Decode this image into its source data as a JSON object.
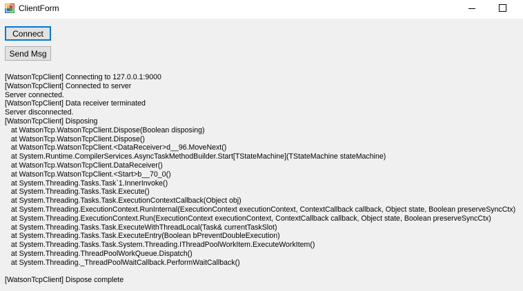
{
  "window": {
    "title": "ClientForm"
  },
  "buttons": {
    "connect": "Connect",
    "send": "Send Msg"
  },
  "log": [
    "[WatsonTcpClient] Connecting to 127.0.0.1:9000",
    "[WatsonTcpClient] Connected to server",
    "Server connected.",
    "[WatsonTcpClient] Data receiver terminated",
    "Server disconnected.",
    "[WatsonTcpClient] Disposing",
    "   at WatsonTcp.WatsonTcpClient.Dispose(Boolean disposing)",
    "   at WatsonTcp.WatsonTcpClient.Dispose()",
    "   at WatsonTcp.WatsonTcpClient.<DataReceiver>d__96.MoveNext()",
    "   at System.Runtime.CompilerServices.AsyncTaskMethodBuilder.Start[TStateMachine](TStateMachine stateMachine)",
    "   at WatsonTcp.WatsonTcpClient.DataReceiver()",
    "   at WatsonTcp.WatsonTcpClient.<Start>b__70_0()",
    "   at System.Threading.Tasks.Task`1.InnerInvoke()",
    "   at System.Threading.Tasks.Task.Execute()",
    "   at System.Threading.Tasks.Task.ExecutionContextCallback(Object obj)",
    "   at System.Threading.ExecutionContext.RunInternal(ExecutionContext executionContext, ContextCallback callback, Object state, Boolean preserveSyncCtx)",
    "   at System.Threading.ExecutionContext.Run(ExecutionContext executionContext, ContextCallback callback, Object state, Boolean preserveSyncCtx)",
    "   at System.Threading.Tasks.Task.ExecuteWithThreadLocal(Task& currentTaskSlot)",
    "   at System.Threading.Tasks.Task.ExecuteEntry(Boolean bPreventDoubleExecution)",
    "   at System.Threading.Tasks.Task.System.Threading.IThreadPoolWorkItem.ExecuteWorkItem()",
    "   at System.Threading.ThreadPoolWorkQueue.Dispatch()",
    "   at System.Threading._ThreadPoolWaitCallback.PerformWaitCallback()",
    "",
    "[WatsonTcpClient] Dispose complete"
  ]
}
